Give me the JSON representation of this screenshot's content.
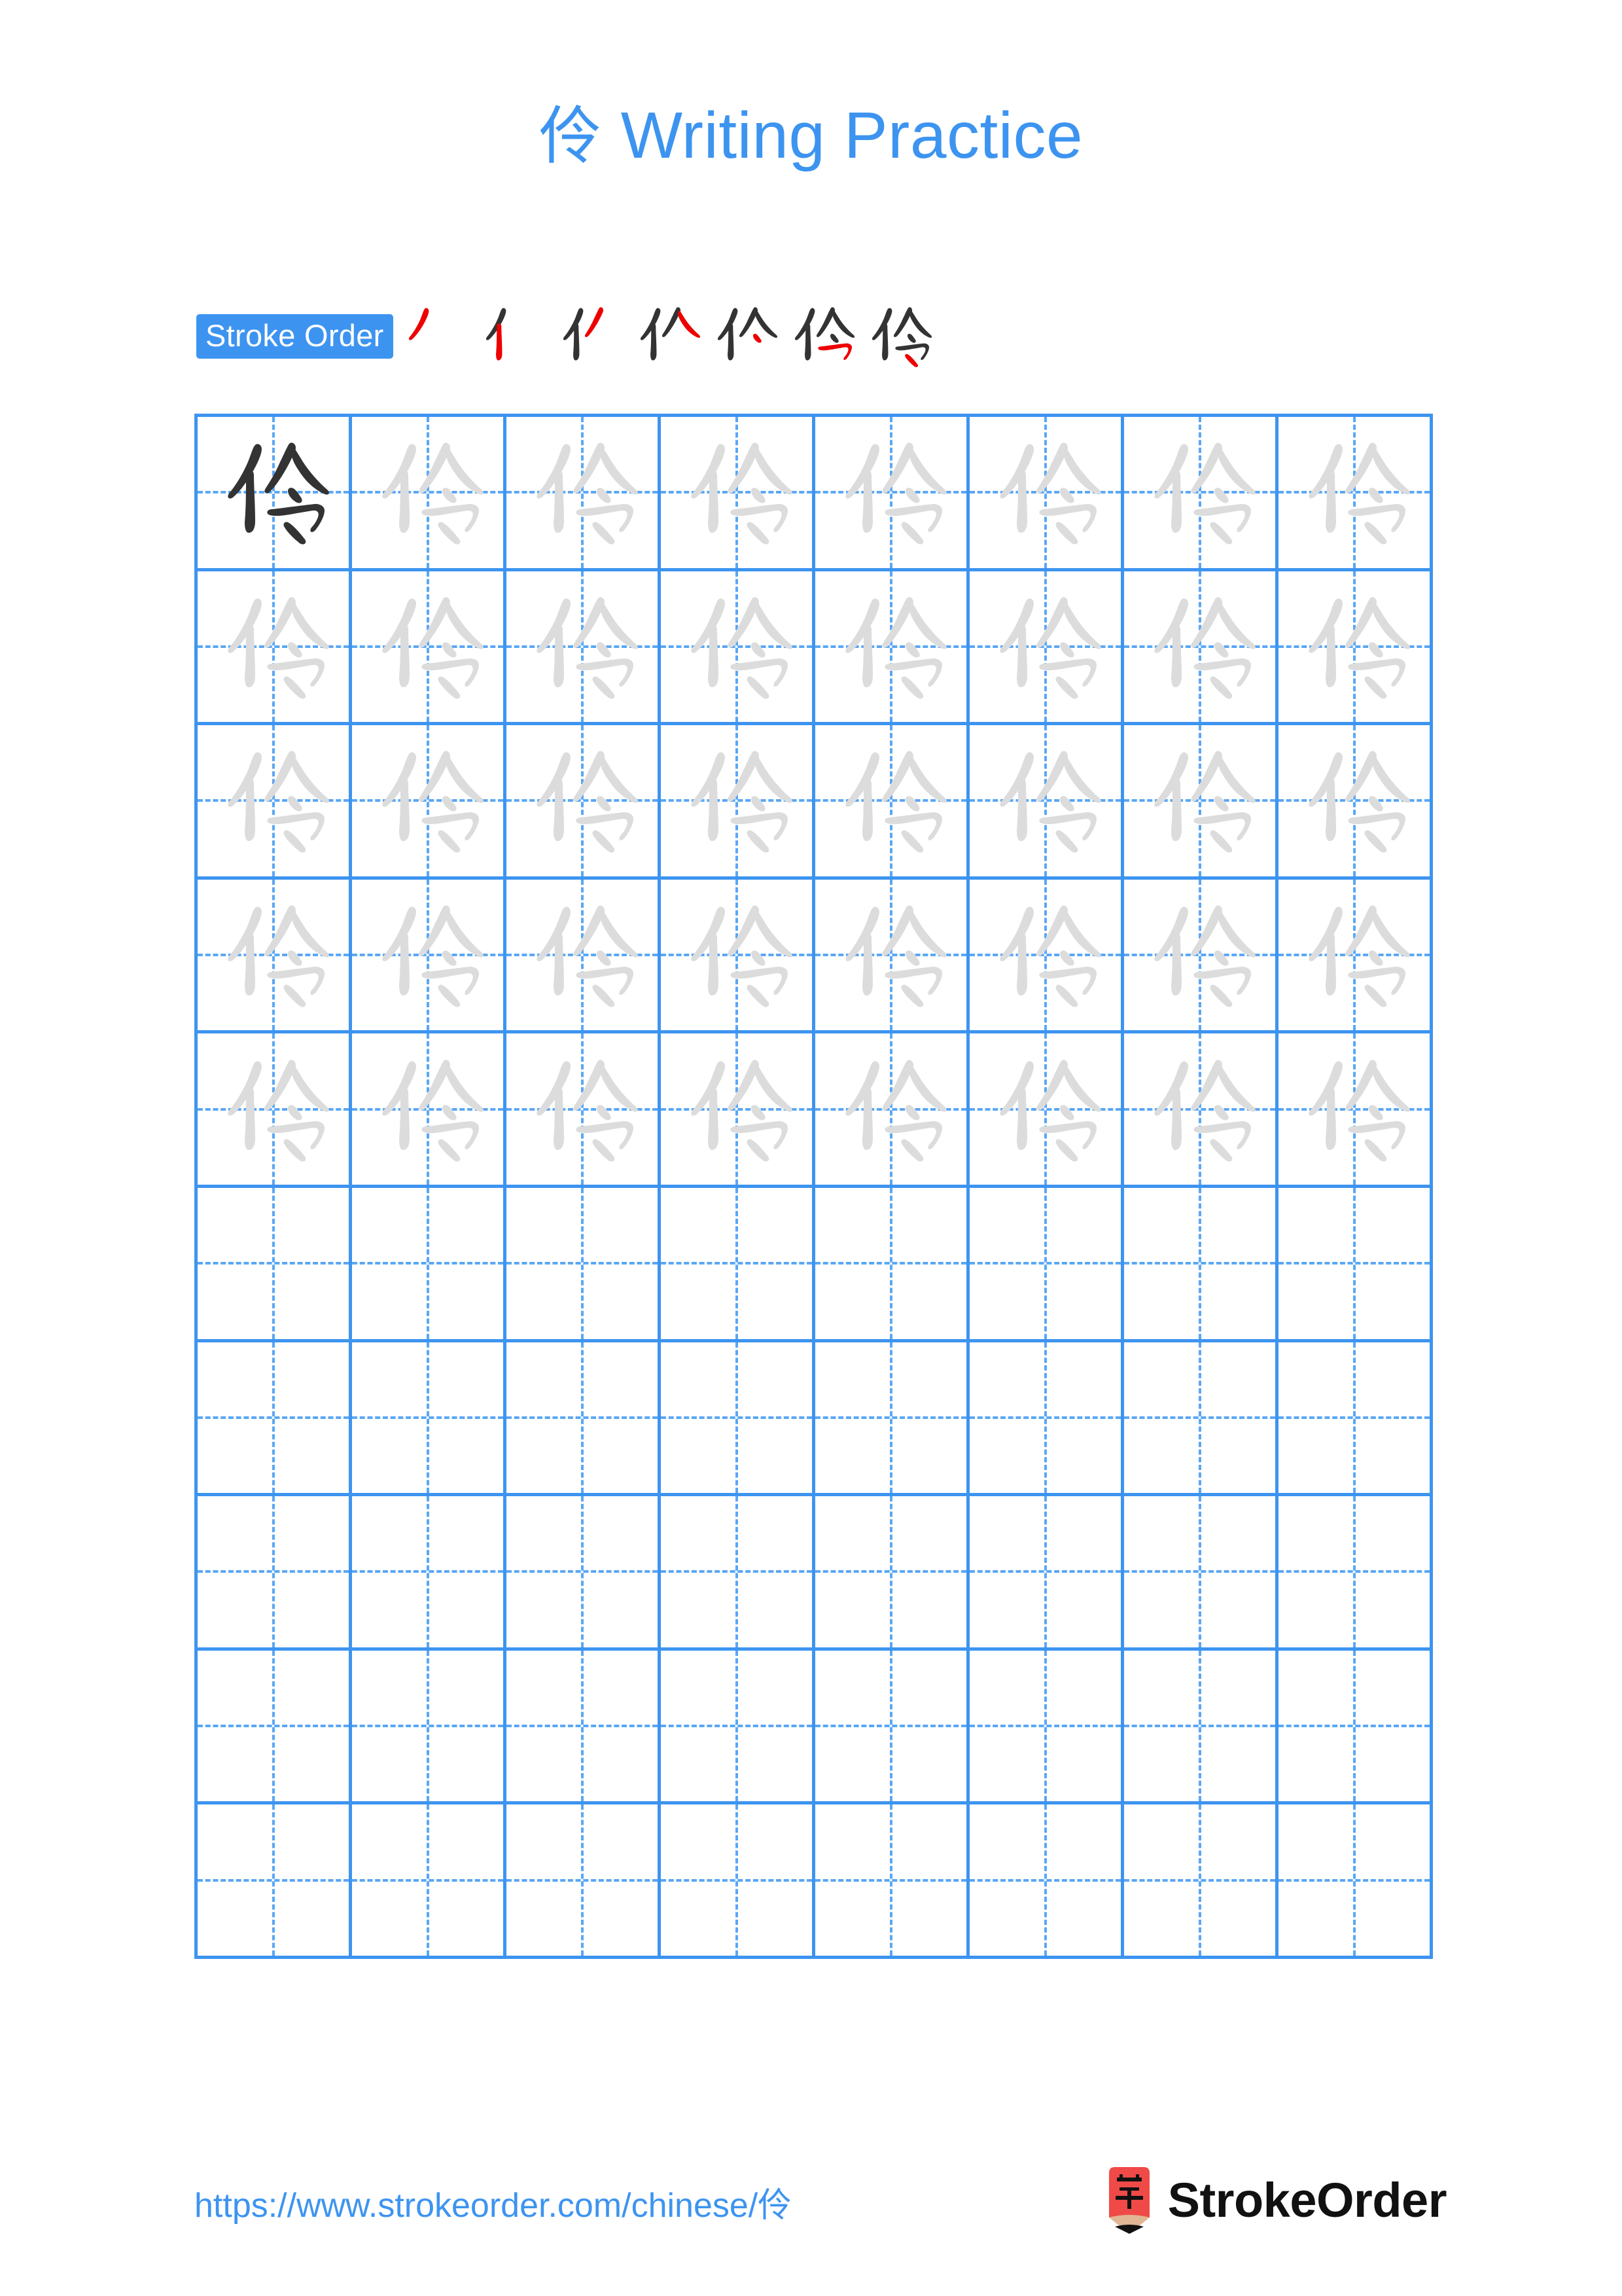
{
  "document": {
    "type": "chinese-character-writing-practice-worksheet",
    "character": "伶",
    "title_text": "伶 Writing Practice",
    "title_character": "伶",
    "title_suffix": " Writing Practice"
  },
  "colors": {
    "accent_blue": "#3d94f0",
    "grid_line": "#3d94f0",
    "grid_dashed": "#5aa7f5",
    "trace_gray": "#dcdcdc",
    "ink_dark": "#333333",
    "highlight_red": "#ee0000",
    "logo_red": "#ef4a47",
    "logo_wood": "#e0b695",
    "page_background": "#ffffff",
    "brand_text": "#111111"
  },
  "stroke_order": {
    "badge_label": "Stroke Order",
    "total_strokes": 7,
    "steps": [
      {
        "index": 1,
        "strokes_shown": 1,
        "new_stroke_name": "撇",
        "new_stroke_index": 1
      },
      {
        "index": 2,
        "strokes_shown": 2,
        "new_stroke_name": "竖",
        "new_stroke_index": 2
      },
      {
        "index": 3,
        "strokes_shown": 3,
        "new_stroke_name": "撇",
        "new_stroke_index": 3
      },
      {
        "index": 4,
        "strokes_shown": 4,
        "new_stroke_name": "捺",
        "new_stroke_index": 4
      },
      {
        "index": 5,
        "strokes_shown": 5,
        "new_stroke_name": "点",
        "new_stroke_index": 5
      },
      {
        "index": 6,
        "strokes_shown": 6,
        "new_stroke_name": "横折",
        "new_stroke_index": 6
      },
      {
        "index": 7,
        "strokes_shown": 7,
        "new_stroke_name": "点",
        "new_stroke_index": 7
      }
    ]
  },
  "practice_grid": {
    "columns": 8,
    "rows": 10,
    "filled_rows": 5,
    "empty_rows": 5,
    "cell_style": "tian-zi-ge",
    "first_cell_is_dark_model": true,
    "trace_character": "伶",
    "rows_data": [
      {
        "row": 1,
        "cells": [
          "model",
          "trace",
          "trace",
          "trace",
          "trace",
          "trace",
          "trace",
          "trace"
        ]
      },
      {
        "row": 2,
        "cells": [
          "trace",
          "trace",
          "trace",
          "trace",
          "trace",
          "trace",
          "trace",
          "trace"
        ]
      },
      {
        "row": 3,
        "cells": [
          "trace",
          "trace",
          "trace",
          "trace",
          "trace",
          "trace",
          "trace",
          "trace"
        ]
      },
      {
        "row": 4,
        "cells": [
          "trace",
          "trace",
          "trace",
          "trace",
          "trace",
          "trace",
          "trace",
          "trace"
        ]
      },
      {
        "row": 5,
        "cells": [
          "trace",
          "trace",
          "trace",
          "trace",
          "trace",
          "trace",
          "trace",
          "trace"
        ]
      },
      {
        "row": 6,
        "cells": [
          "empty",
          "empty",
          "empty",
          "empty",
          "empty",
          "empty",
          "empty",
          "empty"
        ]
      },
      {
        "row": 7,
        "cells": [
          "empty",
          "empty",
          "empty",
          "empty",
          "empty",
          "empty",
          "empty",
          "empty"
        ]
      },
      {
        "row": 8,
        "cells": [
          "empty",
          "empty",
          "empty",
          "empty",
          "empty",
          "empty",
          "empty",
          "empty"
        ]
      },
      {
        "row": 9,
        "cells": [
          "empty",
          "empty",
          "empty",
          "empty",
          "empty",
          "empty",
          "empty",
          "empty"
        ]
      },
      {
        "row": 10,
        "cells": [
          "empty",
          "empty",
          "empty",
          "empty",
          "empty",
          "empty",
          "empty",
          "empty"
        ]
      }
    ]
  },
  "footer": {
    "url_prefix": "https://www.strokeorder.com/chinese/",
    "url_character": "伶",
    "url_full": "https://www.strokeorder.com/chinese/伶",
    "brand_name": "StrokeOrder",
    "brand_mark_character": "字"
  }
}
